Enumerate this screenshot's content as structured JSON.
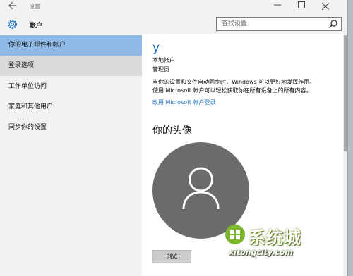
{
  "window": {
    "title": "设置",
    "back_icon": "back-arrow-icon",
    "controls": [
      "minimize-icon",
      "maximize-icon",
      "close-icon"
    ]
  },
  "header": {
    "icon": "gear-icon",
    "title": "帐户"
  },
  "search": {
    "placeholder": "查找设置",
    "icon": "search-icon"
  },
  "sidebar": {
    "items": [
      {
        "label": "你的电子邮件和帐户",
        "state": "selected"
      },
      {
        "label": "登录选项",
        "state": "hover"
      },
      {
        "label": "工作单位访问",
        "state": "normal"
      },
      {
        "label": "家庭和其他用户",
        "state": "normal"
      },
      {
        "label": "同步你的设置",
        "state": "normal"
      }
    ]
  },
  "main": {
    "user_name": "y",
    "account_type": "本地帐户",
    "account_role": "管理员",
    "info_line1": "当你的设置和文件自动同步时，Windows 可以更好地发挥作用。",
    "info_line2": "使用 Microsoft 帐户可以轻松获取你在所有设备上的所有内容。",
    "ms_link": "改用 Microsoft 帐户登录",
    "avatar_title": "你的头像",
    "avatar_icon": "user-placeholder-icon",
    "browse_button": "浏览"
  },
  "watermark": {
    "text": "系统城",
    "domain": "xitongcity.com"
  },
  "colors": {
    "accent": "#1a6fc4",
    "selected_bg": "#8fbae8",
    "hover_bg": "#d9d9d9",
    "avatar_bg": "#6b6b6b",
    "window_bg": "#f2f2f2"
  }
}
